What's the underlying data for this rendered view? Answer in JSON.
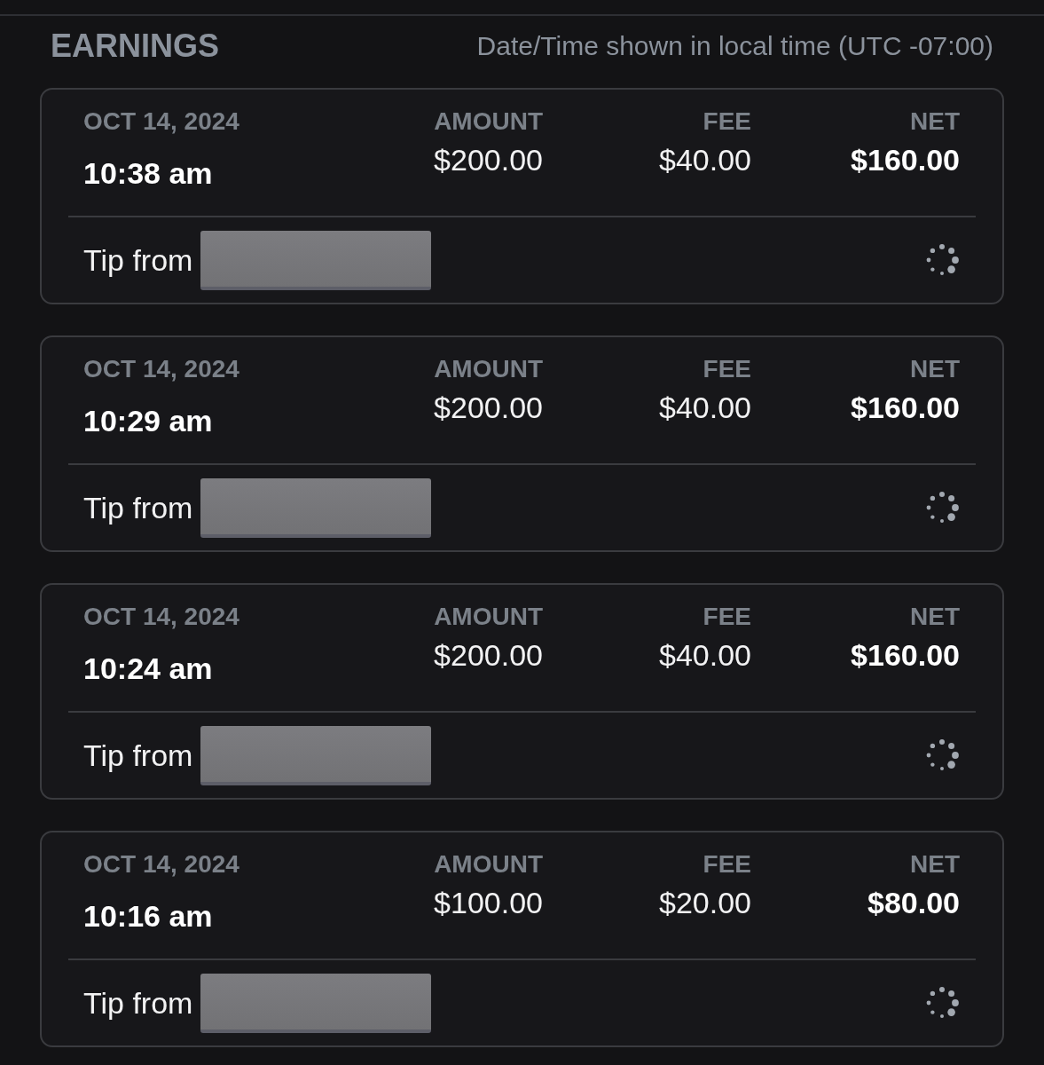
{
  "header": {
    "title": "EARNINGS",
    "timezone_note": "Date/Time shown in local time (UTC -07:00)"
  },
  "earnings": [
    {
      "date": "OCT 14, 2024",
      "time": "10:38 am",
      "amount_label": "AMOUNT",
      "amount": "$200.00",
      "fee_label": "FEE",
      "fee": "$40.00",
      "net_label": "NET",
      "net": "$160.00",
      "description": "Tip from",
      "sender_redacted": true,
      "loading": true
    },
    {
      "date": "OCT 14, 2024",
      "time": "10:29 am",
      "amount_label": "AMOUNT",
      "amount": "$200.00",
      "fee_label": "FEE",
      "fee": "$40.00",
      "net_label": "NET",
      "net": "$160.00",
      "description": "Tip from",
      "sender_redacted": true,
      "loading": true
    },
    {
      "date": "OCT 14, 2024",
      "time": "10:24 am",
      "amount_label": "AMOUNT",
      "amount": "$200.00",
      "fee_label": "FEE",
      "fee": "$40.00",
      "net_label": "NET",
      "net": "$160.00",
      "description": "Tip from",
      "sender_redacted": true,
      "loading": true
    },
    {
      "date": "OCT 14, 2024",
      "time": "10:16 am",
      "amount_label": "AMOUNT",
      "amount": "$100.00",
      "fee_label": "FEE",
      "fee": "$20.00",
      "net_label": "NET",
      "net": "$80.00",
      "description": "Tip from",
      "sender_redacted": true,
      "loading": true
    }
  ]
}
